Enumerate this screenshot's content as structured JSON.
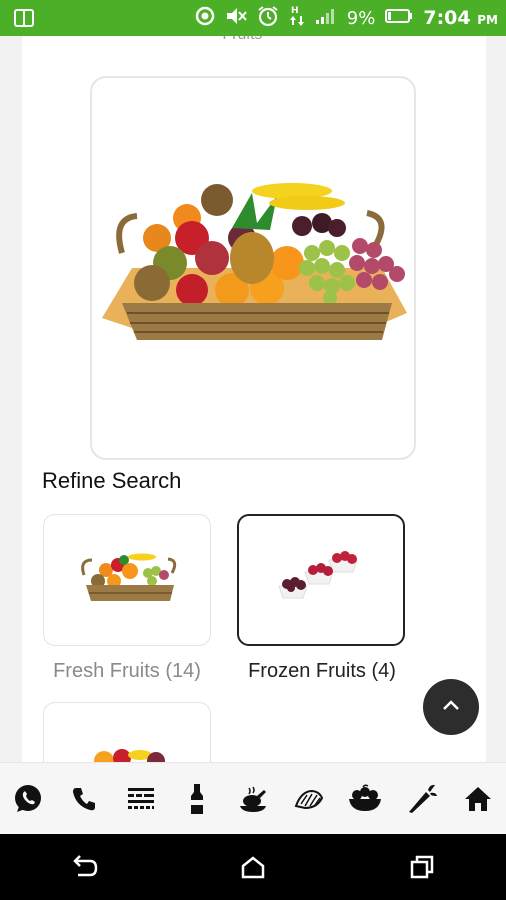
{
  "status_bar": {
    "battery_percent": "9%",
    "time": "7:04",
    "time_suffix": "PM"
  },
  "page": {
    "cut_off_text": "··· Fruits"
  },
  "refine": {
    "title": "Refine Search",
    "categories": [
      {
        "label": "Fresh Fruits (14)",
        "selected": false,
        "label_color": "#8a8a8a"
      },
      {
        "label": "Frozen Fruits (4)",
        "selected": true,
        "label_color": "#222222"
      },
      {
        "label": "",
        "selected": false
      }
    ]
  },
  "bottom_nav": {
    "items": [
      "whatsapp-icon",
      "phone-icon",
      "grid-icon",
      "bottle-icon",
      "cooked-dish-icon",
      "seafood-icon",
      "fruit-bowl-icon",
      "carrot-icon",
      "home-icon"
    ]
  },
  "colors": {
    "status_bar": "#4caf28",
    "nav_icon": "#111111"
  }
}
